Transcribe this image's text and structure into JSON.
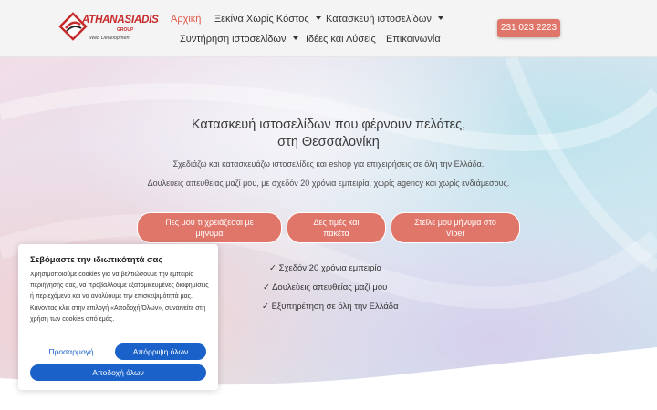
{
  "header": {
    "logo": {
      "brand": "ATHANASIADIS",
      "group": "GROUP",
      "tagline": "Web Development"
    },
    "nav": [
      {
        "label": "Αρχική",
        "active": true
      },
      {
        "label": "Ξεκίνα Χωρίς Κόστος",
        "dropdown": true
      },
      {
        "label": "Κατασκευή ιστοσελίδων",
        "dropdown": true
      },
      {
        "label": "Συντήρηση ιστοσελίδων",
        "dropdown": true
      },
      {
        "label": "Ιδέες και Λύσεις"
      },
      {
        "label": "Επικοινωνία"
      }
    ],
    "phone": "231 023 2223"
  },
  "hero": {
    "title_line1": "Κατασκευή ιστοσελίδων που φέρνουν πελάτες,",
    "title_line2": "στη Θεσσαλονίκη",
    "subtitle1": "Σχεδιάζω και κατασκευάζω ιστοσελίδες και eshop για επιχειρήσεις σε όλη την Ελλάδα.",
    "subtitle2": "Δουλεύεις απευθείας μαζί μου, με σχεδόν 20 χρόνια εμπειρία, χωρίς agency και χωρίς ενδιάμεσους.",
    "buttons": [
      {
        "line1": "Πες μου τι χρειάζεσαι με",
        "line2": "μήνυμα"
      },
      {
        "line1": "Δες τιμές και",
        "line2": "πακέτα"
      },
      {
        "line1": "Στείλε μου μήνυμα στο",
        "line2": "Viber"
      }
    ],
    "checks": [
      "✓ Σχεδόν 20 χρόνια εμπειρία",
      "✓ Δουλεύεις απευθείας μαζί μου",
      "✓ Εξυπηρέτηση σε όλη την Ελλάδα"
    ]
  },
  "cookie": {
    "title": "Σεβόμαστε την ιδιωτικότητά σας",
    "text": "Χρησιμοποιούμε cookies για να βελτιώσουμε την εμπειρία περιήγησής σας, να προβάλλουμε εξατομικευμένες διαφημίσεις ή περιεχόμενο και να αναλύουμε την επισκεψιμότητά μας. Κάνοντας κλικ στην επιλογή «Αποδοχή Όλων», συναινείτε στη χρήση των cookies από εμάς.",
    "customize": "Προσαρμογή",
    "reject": "Απόρριψη όλων",
    "accept": "Αποδοχή όλων"
  },
  "colors": {
    "accent": "#e0766a",
    "active_nav": "#e0584a",
    "cookie_blue": "#1a62c9"
  }
}
